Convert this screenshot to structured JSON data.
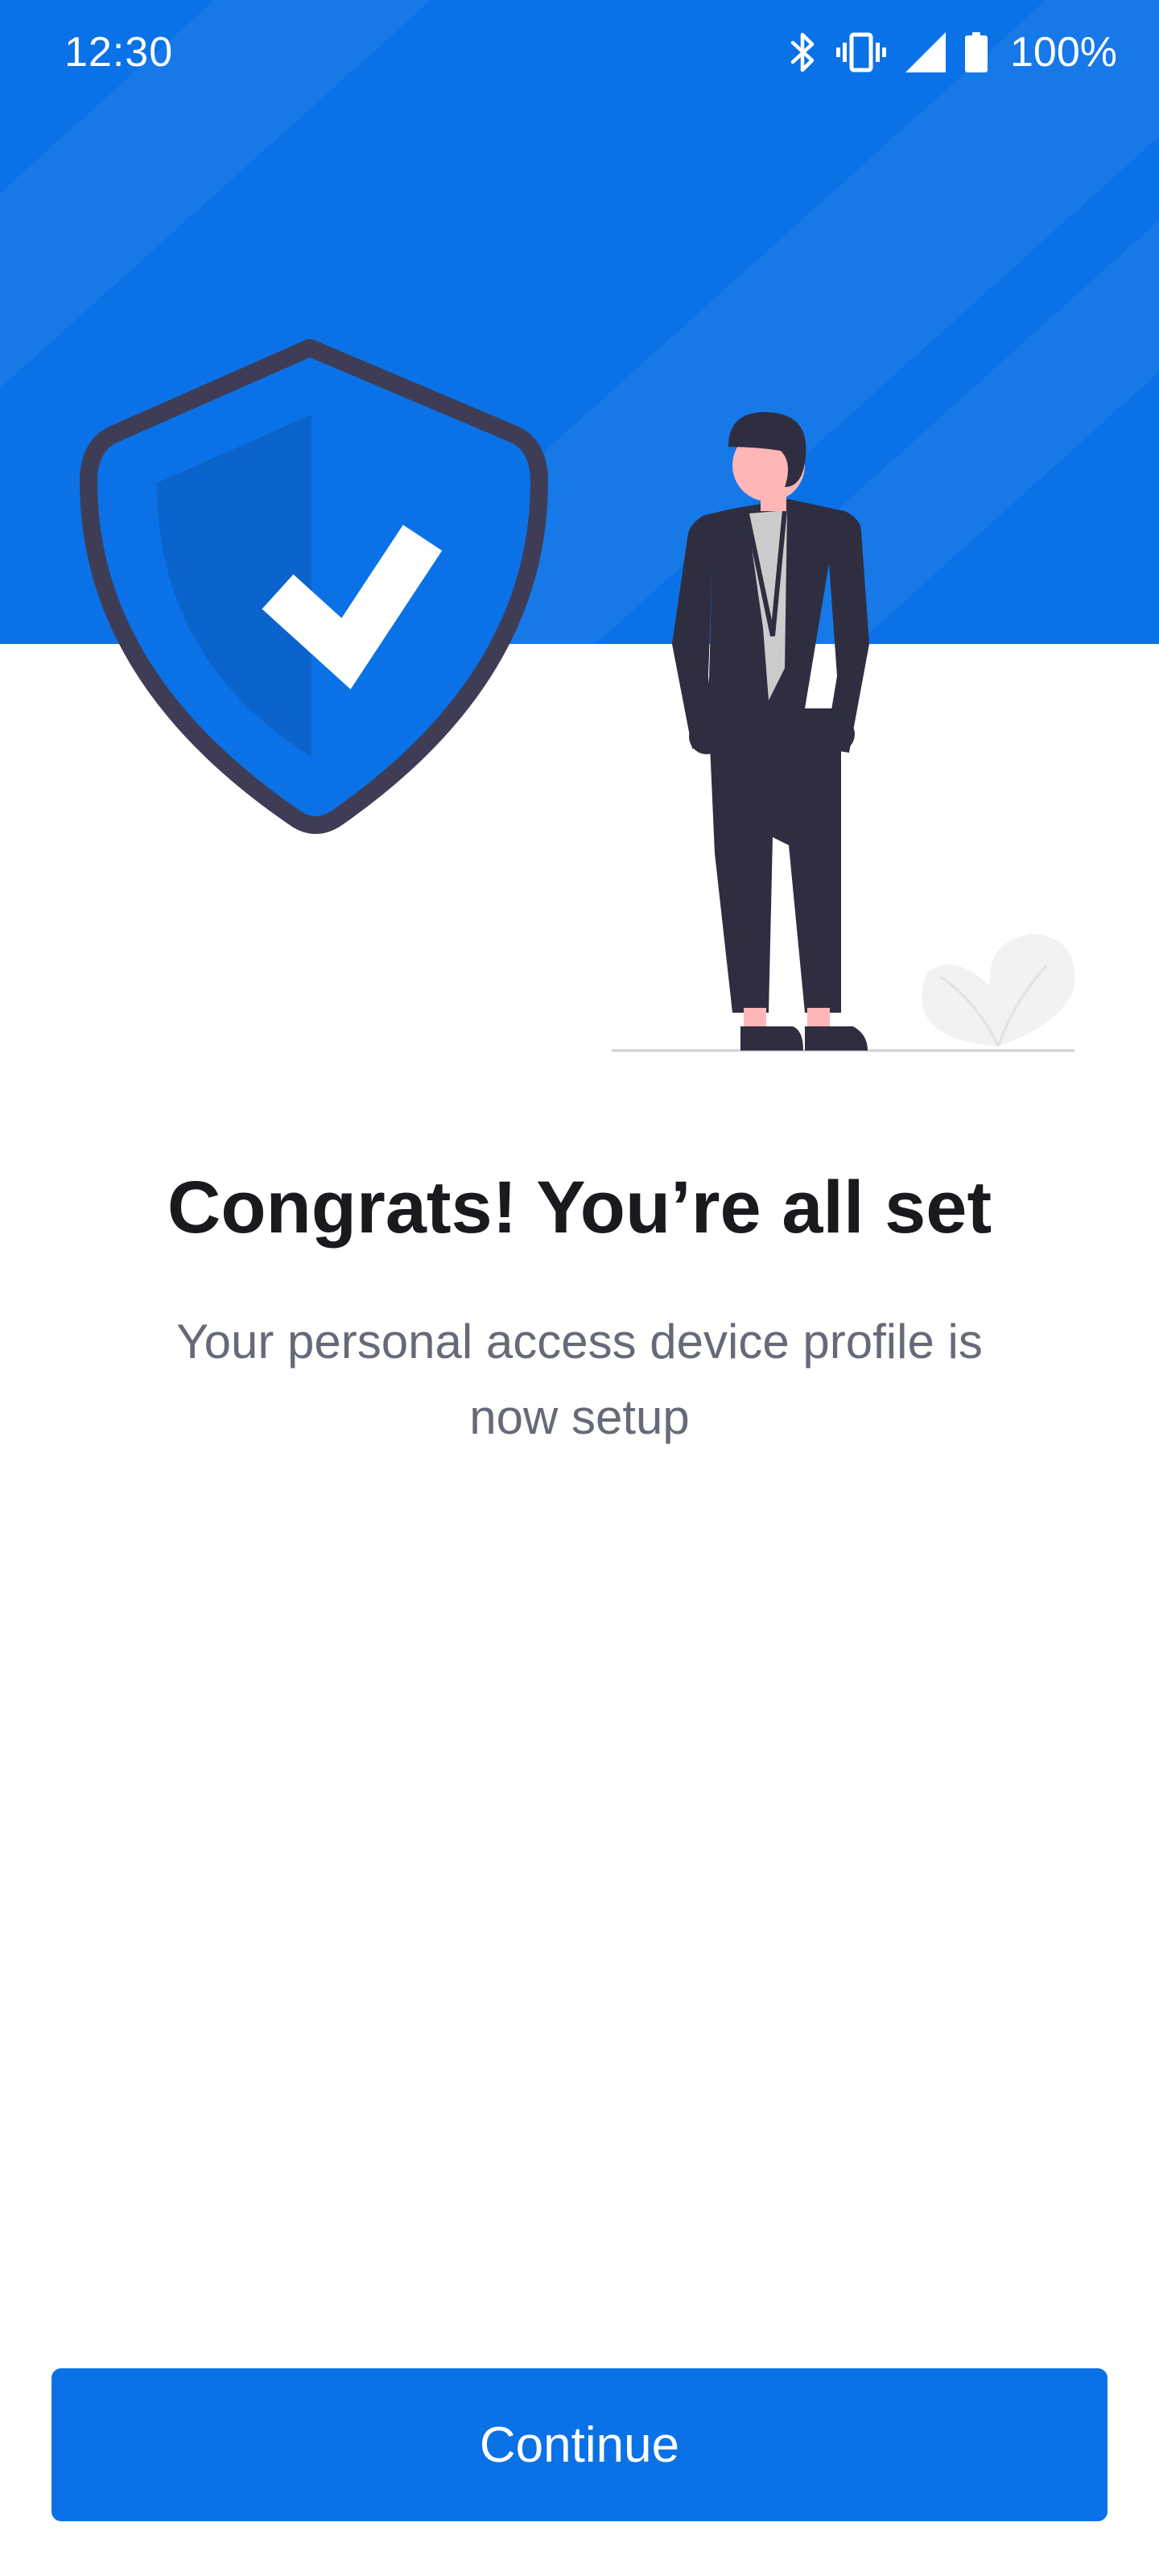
{
  "status_bar": {
    "time": "12:30",
    "icons": [
      "bluetooth-icon",
      "vibrate-icon",
      "cell-signal-icon",
      "battery-icon"
    ],
    "battery": "100%"
  },
  "illustration": {
    "icons": [
      "shield-check-icon",
      "person-figure",
      "plant-icon"
    ]
  },
  "content": {
    "title": "Congrats! You’re all set",
    "subtitle": "Your personal access device profile is now setup"
  },
  "actions": {
    "continue_label": "Continue"
  },
  "colors": {
    "primary": "#0a72e6",
    "shield_border": "#3f3d56",
    "suit": "#2f2e41",
    "skin": "#ffb6b6",
    "title_text": "#1a1a1e",
    "body_text": "#666a78",
    "background": "#ffffff"
  }
}
